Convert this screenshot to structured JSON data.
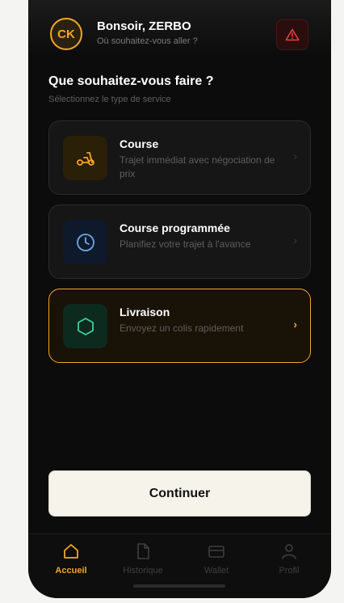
{
  "header": {
    "avatar_initials": "CK",
    "greeting": "Bonsoir, ZERBO",
    "subtitle": "Où souhaitez-vous aller ?",
    "alert_icon": "warning-triangle-icon"
  },
  "section": {
    "title": "Que souhaitez-vous faire ?",
    "subtitle": "Sélectionnez le type de service"
  },
  "services": [
    {
      "name": "Course",
      "description": "Trajet immédiat avec négociation de prix",
      "icon": "scooter-icon",
      "chevron": "›",
      "selected": false
    },
    {
      "name": "Course programmée",
      "description": "Planifiez votre trajet à l'avance",
      "icon": "clock-icon",
      "chevron": "›",
      "selected": false
    },
    {
      "name": "Livraison",
      "description": "Envoyez un colis rapidement",
      "icon": "package-hexagon-icon",
      "chevron": "›",
      "selected": true
    }
  ],
  "continue_label": "Continuer",
  "nav": [
    {
      "label": "Accueil",
      "icon": "home-icon",
      "active": true
    },
    {
      "label": "Historique",
      "icon": "document-icon",
      "active": false
    },
    {
      "label": "Wallet",
      "icon": "card-icon",
      "active": false
    },
    {
      "label": "Profil",
      "icon": "user-icon",
      "active": false
    }
  ],
  "colors": {
    "accent": "#f5a623",
    "background": "#0c0c0c",
    "card": "#161616",
    "danger": "#e0433b"
  }
}
